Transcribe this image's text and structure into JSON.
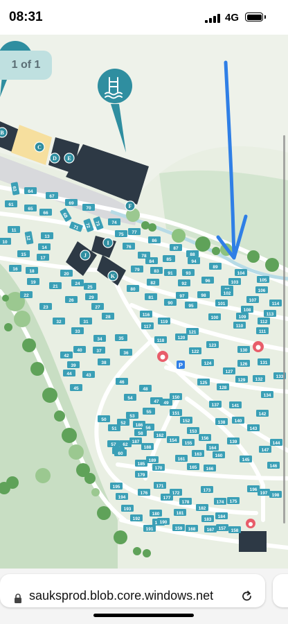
{
  "status_bar": {
    "time": "08:31",
    "network": "4G",
    "icons": [
      "signal-icon",
      "battery-icon"
    ]
  },
  "map": {
    "page_indicator": "1 of 1",
    "icons": [
      "swimming-pool-icon",
      "fire-icon",
      "parking-icon",
      "arrow-annotation-icon"
    ],
    "building_labels": [
      "B",
      "C",
      "D",
      "E",
      "F",
      "I",
      "J",
      "K"
    ],
    "parking_label": "P",
    "plots": [
      {
        "n": "63"
      },
      {
        "n": "64"
      },
      {
        "n": "67"
      },
      {
        "n": "69"
      },
      {
        "n": "70"
      },
      {
        "n": "61"
      },
      {
        "n": "65"
      },
      {
        "n": "66"
      },
      {
        "n": "68"
      },
      {
        "n": "71"
      },
      {
        "n": "72"
      },
      {
        "n": "73"
      },
      {
        "n": "74"
      },
      {
        "n": "75"
      },
      {
        "n": "77"
      },
      {
        "n": "11"
      },
      {
        "n": "12"
      },
      {
        "n": "13"
      },
      {
        "n": "10"
      },
      {
        "n": "14"
      },
      {
        "n": "15"
      },
      {
        "n": "17"
      },
      {
        "n": "16"
      },
      {
        "n": "18"
      },
      {
        "n": "20"
      },
      {
        "n": "19"
      },
      {
        "n": "21"
      },
      {
        "n": "24"
      },
      {
        "n": "25"
      },
      {
        "n": "22"
      },
      {
        "n": "23"
      },
      {
        "n": "26"
      },
      {
        "n": "27"
      },
      {
        "n": "29"
      },
      {
        "n": "28"
      },
      {
        "n": "32"
      },
      {
        "n": "31"
      },
      {
        "n": "33"
      },
      {
        "n": "34"
      },
      {
        "n": "35"
      },
      {
        "n": "40"
      },
      {
        "n": "37"
      },
      {
        "n": "36"
      },
      {
        "n": "42"
      },
      {
        "n": "39"
      },
      {
        "n": "38"
      },
      {
        "n": "44"
      },
      {
        "n": "43"
      },
      {
        "n": "45"
      },
      {
        "n": "76"
      },
      {
        "n": "78"
      },
      {
        "n": "79"
      },
      {
        "n": "80"
      },
      {
        "n": "86"
      },
      {
        "n": "87"
      },
      {
        "n": "84"
      },
      {
        "n": "85"
      },
      {
        "n": "83"
      },
      {
        "n": "82"
      },
      {
        "n": "81"
      },
      {
        "n": "88"
      },
      {
        "n": "89"
      },
      {
        "n": "90"
      },
      {
        "n": "91"
      },
      {
        "n": "92"
      },
      {
        "n": "93"
      },
      {
        "n": "94"
      },
      {
        "n": "95"
      },
      {
        "n": "96"
      },
      {
        "n": "97"
      },
      {
        "n": "98"
      },
      {
        "n": "99"
      },
      {
        "n": "100"
      },
      {
        "n": "101"
      },
      {
        "n": "102"
      },
      {
        "n": "103"
      },
      {
        "n": "104"
      },
      {
        "n": "105"
      },
      {
        "n": "106"
      },
      {
        "n": "107"
      },
      {
        "n": "108"
      },
      {
        "n": "109"
      },
      {
        "n": "110"
      },
      {
        "n": "111"
      },
      {
        "n": "112"
      },
      {
        "n": "113"
      },
      {
        "n": "114"
      },
      {
        "n": "116"
      },
      {
        "n": "117"
      },
      {
        "n": "118"
      },
      {
        "n": "119"
      },
      {
        "n": "120"
      },
      {
        "n": "121"
      },
      {
        "n": "122"
      },
      {
        "n": "123"
      },
      {
        "n": "124"
      },
      {
        "n": "125"
      },
      {
        "n": "126"
      },
      {
        "n": "127"
      },
      {
        "n": "128"
      },
      {
        "n": "129"
      },
      {
        "n": "130"
      },
      {
        "n": "131"
      },
      {
        "n": "132"
      },
      {
        "n": "133"
      },
      {
        "n": "134"
      },
      {
        "n": "137"
      },
      {
        "n": "141"
      },
      {
        "n": "142"
      },
      {
        "n": "138"
      },
      {
        "n": "140"
      },
      {
        "n": "143"
      },
      {
        "n": "139"
      },
      {
        "n": "144"
      },
      {
        "n": "145"
      },
      {
        "n": "147"
      },
      {
        "n": "146"
      },
      {
        "n": "46"
      },
      {
        "n": "48"
      },
      {
        "n": "47"
      },
      {
        "n": "49"
      },
      {
        "n": "50"
      },
      {
        "n": "51"
      },
      {
        "n": "52"
      },
      {
        "n": "53"
      },
      {
        "n": "54"
      },
      {
        "n": "55"
      },
      {
        "n": "56"
      },
      {
        "n": "57"
      },
      {
        "n": "58"
      },
      {
        "n": "59"
      },
      {
        "n": "60"
      },
      {
        "n": "62"
      },
      {
        "n": "150"
      },
      {
        "n": "151"
      },
      {
        "n": "152"
      },
      {
        "n": "153"
      },
      {
        "n": "154"
      },
      {
        "n": "155"
      },
      {
        "n": "156"
      },
      {
        "n": "157"
      },
      {
        "n": "158"
      },
      {
        "n": "159"
      },
      {
        "n": "160"
      },
      {
        "n": "161"
      },
      {
        "n": "162"
      },
      {
        "n": "163"
      },
      {
        "n": "164"
      },
      {
        "n": "165"
      },
      {
        "n": "166"
      },
      {
        "n": "167"
      },
      {
        "n": "168"
      },
      {
        "n": "169"
      },
      {
        "n": "170"
      },
      {
        "n": "171"
      },
      {
        "n": "172"
      },
      {
        "n": "173"
      },
      {
        "n": "174"
      },
      {
        "n": "175"
      },
      {
        "n": "176"
      },
      {
        "n": "177"
      },
      {
        "n": "178"
      },
      {
        "n": "179"
      },
      {
        "n": "180"
      },
      {
        "n": "181"
      },
      {
        "n": "182"
      },
      {
        "n": "183"
      },
      {
        "n": "184"
      },
      {
        "n": "185"
      },
      {
        "n": "186"
      },
      {
        "n": "187"
      },
      {
        "n": "188"
      },
      {
        "n": "189"
      },
      {
        "n": "190"
      },
      {
        "n": "191"
      },
      {
        "n": "192"
      },
      {
        "n": "193"
      },
      {
        "n": "194"
      },
      {
        "n": "195"
      },
      {
        "n": "196"
      },
      {
        "n": "197"
      },
      {
        "n": "198"
      }
    ]
  },
  "browser": {
    "url": "sauksprod.blob.core.windows.net",
    "icons": [
      "lock-icon",
      "reload-icon"
    ]
  },
  "colors": {
    "plot": "#3a9fb6",
    "plot_text": "#ffffff",
    "building": "#2d3945",
    "grass": "#c5dcc2",
    "path": "#ffffff",
    "annotation": "#2f7fe6",
    "highlight_building": "#f6df9e",
    "fire": "#e85d6a"
  }
}
